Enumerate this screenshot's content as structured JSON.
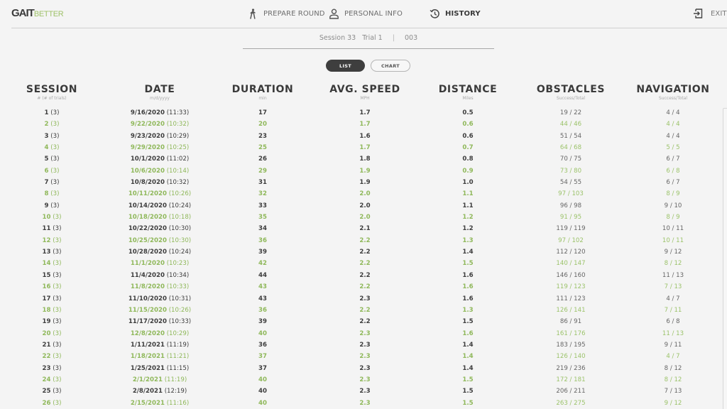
{
  "app": {
    "logo_primary": "GAIT",
    "logo_secondary": "BETTER",
    "accent_color": "#8fb85a"
  },
  "nav": {
    "prepare_round": "PREPARE ROUND",
    "personal_info": "PERSONAL INFO",
    "history": "HISTORY",
    "exit": "EXIT",
    "active": "history"
  },
  "session_info": {
    "session": "Session 33",
    "trial": "Trial 1",
    "separator": "|",
    "id": "003"
  },
  "view_toggle": {
    "list_label": "LIST",
    "chart_label": "CHART",
    "selected": "LIST"
  },
  "table": {
    "columns": [
      {
        "key": "session",
        "title": "SESSION",
        "unit": "# (# of trials)"
      },
      {
        "key": "date",
        "title": "DATE",
        "unit": "m/d/yyyy"
      },
      {
        "key": "duration",
        "title": "DURATION",
        "unit": "min"
      },
      {
        "key": "speed",
        "title": "AVG. SPEED",
        "unit": "MPH"
      },
      {
        "key": "distance",
        "title": "DISTANCE",
        "unit": "Miles"
      },
      {
        "key": "obstacles",
        "title": "OBSTACLES",
        "unit": "Success/Total"
      },
      {
        "key": "navigation",
        "title": "NAVIGATION",
        "unit": "Success/Total"
      }
    ],
    "rows": [
      {
        "session": "1",
        "trials": "(3)",
        "date": "9/16/2020",
        "time": "(11:33)",
        "duration": "17",
        "speed": "1.7",
        "distance": "0.5",
        "obstacles": "19 / 22",
        "navigation": "4 / 4"
      },
      {
        "session": "2",
        "trials": "(3)",
        "date": "9/22/2020",
        "time": "(10:32)",
        "duration": "20",
        "speed": "1.7",
        "distance": "0.6",
        "obstacles": "44 / 46",
        "navigation": "4 / 4"
      },
      {
        "session": "3",
        "trials": "(3)",
        "date": "9/23/2020",
        "time": "(10:29)",
        "duration": "23",
        "speed": "1.6",
        "distance": "0.6",
        "obstacles": "51 / 54",
        "navigation": "4 / 4"
      },
      {
        "session": "4",
        "trials": "(3)",
        "date": "9/29/2020",
        "time": "(10:25)",
        "duration": "25",
        "speed": "1.7",
        "distance": "0.7",
        "obstacles": "64 / 68",
        "navigation": "5 / 5"
      },
      {
        "session": "5",
        "trials": "(3)",
        "date": "10/1/2020",
        "time": "(11:02)",
        "duration": "26",
        "speed": "1.8",
        "distance": "0.8",
        "obstacles": "70 / 75",
        "navigation": "6 / 7"
      },
      {
        "session": "6",
        "trials": "(3)",
        "date": "10/6/2020",
        "time": "(10:14)",
        "duration": "29",
        "speed": "1.9",
        "distance": "0.9",
        "obstacles": "73 / 80",
        "navigation": "6 / 8"
      },
      {
        "session": "7",
        "trials": "(3)",
        "date": "10/8/2020",
        "time": "(10:32)",
        "duration": "31",
        "speed": "1.9",
        "distance": "1.0",
        "obstacles": "54 / 55",
        "navigation": "6 / 7"
      },
      {
        "session": "8",
        "trials": "(3)",
        "date": "10/11/2020",
        "time": "(10:26)",
        "duration": "32",
        "speed": "2.0",
        "distance": "1.1",
        "obstacles": "97 / 103",
        "navigation": "8 / 9"
      },
      {
        "session": "9",
        "trials": "(3)",
        "date": "10/14/2020",
        "time": "(10:24)",
        "duration": "33",
        "speed": "2.0",
        "distance": "1.1",
        "obstacles": "96 / 98",
        "navigation": "9 / 10"
      },
      {
        "session": "10",
        "trials": "(3)",
        "date": "10/18/2020",
        "time": "(10:18)",
        "duration": "35",
        "speed": "2.0",
        "distance": "1.2",
        "obstacles": "91 / 95",
        "navigation": "8 / 9"
      },
      {
        "session": "11",
        "trials": "(3)",
        "date": "10/22/2020",
        "time": "(10:30)",
        "duration": "34",
        "speed": "2.1",
        "distance": "1.2",
        "obstacles": "119 / 119",
        "navigation": "10 / 11"
      },
      {
        "session": "12",
        "trials": "(3)",
        "date": "10/25/2020",
        "time": "(10:30)",
        "duration": "36",
        "speed": "2.2",
        "distance": "1.3",
        "obstacles": "97 / 102",
        "navigation": "10 / 11"
      },
      {
        "session": "13",
        "trials": "(3)",
        "date": "10/28/2020",
        "time": "(10:24)",
        "duration": "39",
        "speed": "2.2",
        "distance": "1.4",
        "obstacles": "112 / 120",
        "navigation": "9 / 12"
      },
      {
        "session": "14",
        "trials": "(3)",
        "date": "11/1/2020",
        "time": "(10:23)",
        "duration": "42",
        "speed": "2.2",
        "distance": "1.5",
        "obstacles": "140 / 147",
        "navigation": "8 / 12"
      },
      {
        "session": "15",
        "trials": "(3)",
        "date": "11/4/2020",
        "time": "(10:34)",
        "duration": "44",
        "speed": "2.2",
        "distance": "1.6",
        "obstacles": "146 / 160",
        "navigation": "11 / 13"
      },
      {
        "session": "16",
        "trials": "(3)",
        "date": "11/8/2020",
        "time": "(10:33)",
        "duration": "43",
        "speed": "2.2",
        "distance": "1.6",
        "obstacles": "119 / 123",
        "navigation": "7 / 13"
      },
      {
        "session": "17",
        "trials": "(3)",
        "date": "11/10/2020",
        "time": "(10:31)",
        "duration": "43",
        "speed": "2.3",
        "distance": "1.6",
        "obstacles": "111 / 123",
        "navigation": "4 / 7"
      },
      {
        "session": "18",
        "trials": "(3)",
        "date": "11/15/2020",
        "time": "(10:26)",
        "duration": "36",
        "speed": "2.2",
        "distance": "1.3",
        "obstacles": "126 / 141",
        "navigation": "7 / 11"
      },
      {
        "session": "19",
        "trials": "(3)",
        "date": "11/17/2020",
        "time": "(10:33)",
        "duration": "39",
        "speed": "2.2",
        "distance": "1.5",
        "obstacles": "86 / 91",
        "navigation": "6 / 8"
      },
      {
        "session": "20",
        "trials": "(3)",
        "date": "12/8/2020",
        "time": "(10:29)",
        "duration": "40",
        "speed": "2.3",
        "distance": "1.6",
        "obstacles": "161 / 176",
        "navigation": "11 / 13"
      },
      {
        "session": "21",
        "trials": "(3)",
        "date": "1/11/2021",
        "time": "(11:19)",
        "duration": "36",
        "speed": "2.3",
        "distance": "1.4",
        "obstacles": "183 / 195",
        "navigation": "9 / 11"
      },
      {
        "session": "22",
        "trials": "(3)",
        "date": "1/18/2021",
        "time": "(11:21)",
        "duration": "37",
        "speed": "2.3",
        "distance": "1.4",
        "obstacles": "126 / 140",
        "navigation": "4 / 7"
      },
      {
        "session": "23",
        "trials": "(3)",
        "date": "1/25/2021",
        "time": "(11:15)",
        "duration": "37",
        "speed": "2.3",
        "distance": "1.4",
        "obstacles": "219 / 236",
        "navigation": "8 / 12"
      },
      {
        "session": "24",
        "trials": "(3)",
        "date": "2/1/2021",
        "time": "(11:19)",
        "duration": "40",
        "speed": "2.3",
        "distance": "1.5",
        "obstacles": "172 / 181",
        "navigation": "8 / 12"
      },
      {
        "session": "25",
        "trials": "(3)",
        "date": "2/8/2021",
        "time": "(12:19)",
        "duration": "40",
        "speed": "2.3",
        "distance": "1.5",
        "obstacles": "206 / 211",
        "navigation": "7 / 13"
      },
      {
        "session": "26",
        "trials": "(3)",
        "date": "2/15/2021",
        "time": "(11:16)",
        "duration": "40",
        "speed": "2.3",
        "distance": "1.5",
        "obstacles": "263 / 275",
        "navigation": "9 / 12"
      }
    ]
  }
}
